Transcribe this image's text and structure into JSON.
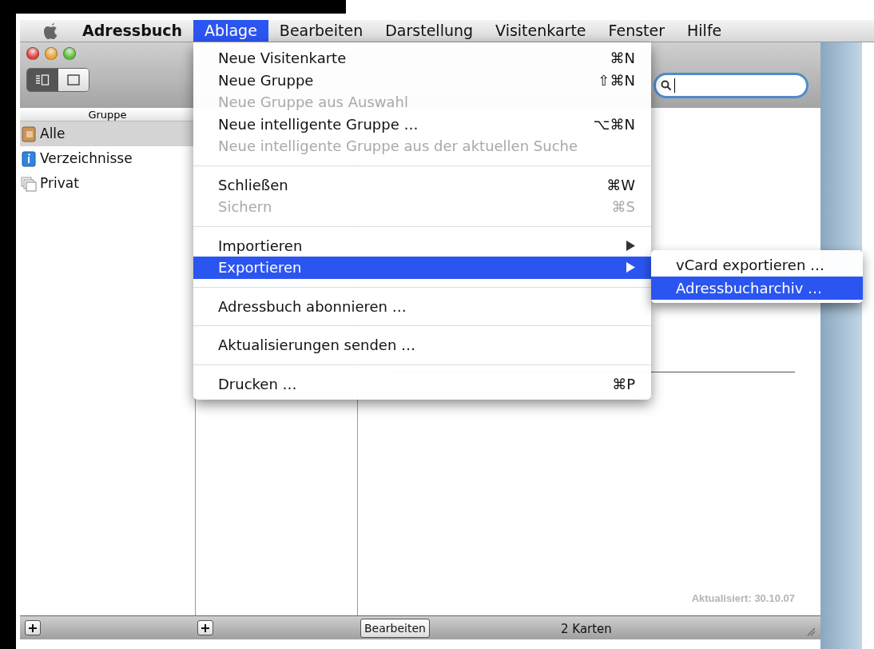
{
  "menubar": {
    "app": "Adressbuch",
    "menus": [
      {
        "label": "Ablage",
        "selected": true
      },
      {
        "label": "Bearbeiten",
        "selected": false
      },
      {
        "label": "Darstellung",
        "selected": false
      },
      {
        "label": "Visitenkarte",
        "selected": false
      },
      {
        "label": "Fenster",
        "selected": false
      },
      {
        "label": "Hilfe",
        "selected": false
      }
    ]
  },
  "menu": {
    "sections": [
      [
        {
          "label": "Neue Visitenkarte",
          "shortcut": "⌘N",
          "disabled": false,
          "selected": false,
          "submenu": false
        },
        {
          "label": "Neue Gruppe",
          "shortcut": "⇧⌘N",
          "disabled": false,
          "selected": false,
          "submenu": false
        },
        {
          "label": "Neue Gruppe aus Auswahl",
          "disabled": true,
          "selected": false,
          "submenu": false
        },
        {
          "label": "Neue intelligente Gruppe …",
          "shortcut": "⌥⌘N",
          "disabled": false,
          "selected": false,
          "submenu": false
        },
        {
          "label": "Neue intelligente Gruppe aus der aktuellen Suche",
          "disabled": true,
          "selected": false,
          "submenu": false
        }
      ],
      [
        {
          "label": "Schließen",
          "shortcut": "⌘W",
          "disabled": false,
          "selected": false,
          "submenu": false
        },
        {
          "label": "Sichern",
          "shortcut": "⌘S",
          "disabled": true,
          "selected": false,
          "submenu": false
        }
      ],
      [
        {
          "label": "Importieren",
          "disabled": false,
          "selected": false,
          "submenu": true
        },
        {
          "label": "Exportieren",
          "disabled": false,
          "selected": true,
          "submenu": true
        }
      ],
      [
        {
          "label": "Adressbuch abonnieren …",
          "disabled": false,
          "selected": false,
          "submenu": false
        }
      ],
      [
        {
          "label": "Aktualisierungen senden …",
          "disabled": false,
          "selected": false,
          "submenu": false
        }
      ],
      [
        {
          "label": "Drucken …",
          "shortcut": "⌘P",
          "disabled": false,
          "selected": false,
          "submenu": false
        }
      ]
    ]
  },
  "submenu": {
    "items": [
      {
        "label": "vCard exportieren …",
        "selected": false
      },
      {
        "label": "Adressbucharchiv …",
        "selected": true
      }
    ]
  },
  "toolbar": {
    "view_modes": [
      {
        "kind": "split",
        "selected": true
      },
      {
        "kind": "card",
        "selected": false
      }
    ],
    "search": {
      "focused": true
    }
  },
  "sidebar": {
    "header": "Gruppe",
    "items": [
      {
        "label": "Alle",
        "kind": "book",
        "selected": true
      },
      {
        "label": "Verzeichnisse",
        "kind": "directory",
        "selected": false
      },
      {
        "label": "Privat",
        "kind": "group",
        "selected": false
      }
    ]
  },
  "card": {
    "updated": "Aktualisiert: 30.10.07"
  },
  "bottom_bar": {
    "edit_button": "Bearbeiten",
    "count": "2 Karten"
  }
}
